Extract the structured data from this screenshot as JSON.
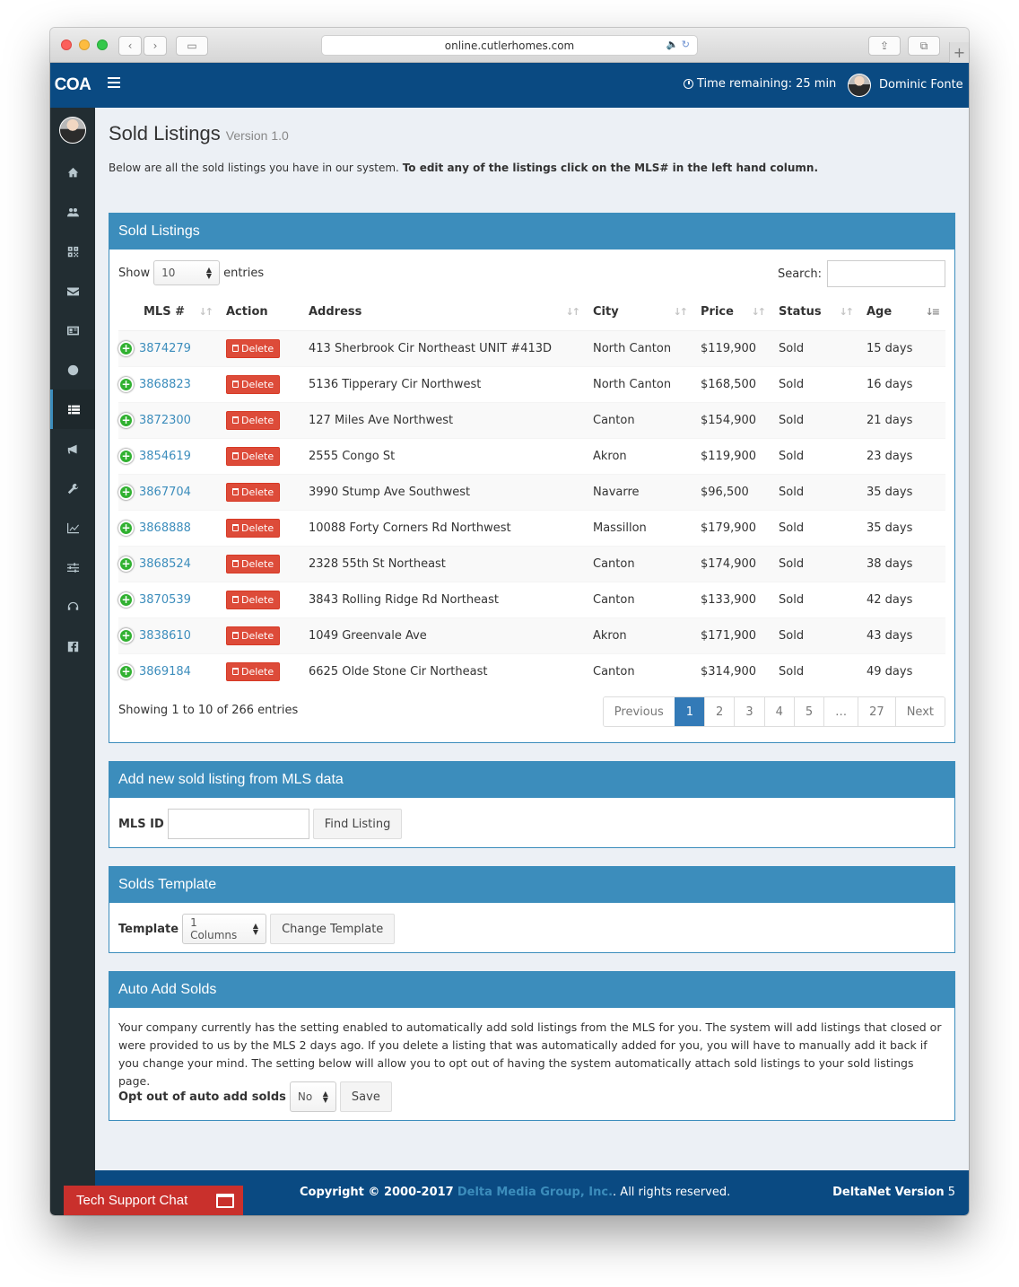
{
  "browser": {
    "url": "online.cutlerhomes.com"
  },
  "header": {
    "logo": "COA",
    "time_remaining": "Time remaining: 25 min",
    "user_name": "Dominic Fonte"
  },
  "sidebar": {
    "items": [
      {
        "icon": "home-icon"
      },
      {
        "icon": "users-icon"
      },
      {
        "icon": "qrcode-icon"
      },
      {
        "icon": "envelope-icon"
      },
      {
        "icon": "address-card-icon"
      },
      {
        "icon": "globe-icon"
      },
      {
        "icon": "list-icon",
        "active": true
      },
      {
        "icon": "bullhorn-icon"
      },
      {
        "icon": "wrench-icon"
      },
      {
        "icon": "line-chart-icon"
      },
      {
        "icon": "sliders-icon"
      },
      {
        "icon": "headset-icon"
      },
      {
        "icon": "facebook-icon"
      }
    ]
  },
  "page": {
    "title": "Sold Listings",
    "version": "Version 1.0",
    "intro_plain": "Below are all the sold listings you have in our system.",
    "intro_bold": "To edit any of the listings click on the MLS# in the left hand column."
  },
  "sold_listings": {
    "header": "Sold Listings",
    "show_label": "Show",
    "entries_label": "entries",
    "page_size": "10",
    "search_label": "Search:",
    "columns": [
      "MLS #",
      "Action",
      "Address",
      "City",
      "Price",
      "Status",
      "Age"
    ],
    "delete_label": "Delete",
    "rows": [
      {
        "mls": "3874279",
        "address": "413 Sherbrook Cir Northeast UNIT #413D",
        "city": "North Canton",
        "price": "$119,900",
        "status": "Sold",
        "age": "15 days"
      },
      {
        "mls": "3868823",
        "address": "5136 Tipperary Cir Northwest",
        "city": "North Canton",
        "price": "$168,500",
        "status": "Sold",
        "age": "16 days"
      },
      {
        "mls": "3872300",
        "address": "127 Miles Ave Northwest",
        "city": "Canton",
        "price": "$154,900",
        "status": "Sold",
        "age": "21 days"
      },
      {
        "mls": "3854619",
        "address": "2555 Congo St",
        "city": "Akron",
        "price": "$119,900",
        "status": "Sold",
        "age": "23 days"
      },
      {
        "mls": "3867704",
        "address": "3990 Stump Ave Southwest",
        "city": "Navarre",
        "price": "$96,500",
        "status": "Sold",
        "age": "35 days"
      },
      {
        "mls": "3868888",
        "address": "10088 Forty Corners Rd Northwest",
        "city": "Massillon",
        "price": "$179,900",
        "status": "Sold",
        "age": "35 days"
      },
      {
        "mls": "3868524",
        "address": "2328 55th St Northeast",
        "city": "Canton",
        "price": "$174,900",
        "status": "Sold",
        "age": "38 days"
      },
      {
        "mls": "3870539",
        "address": "3843 Rolling Ridge Rd Northeast",
        "city": "Canton",
        "price": "$133,900",
        "status": "Sold",
        "age": "42 days"
      },
      {
        "mls": "3838610",
        "address": "1049 Greenvale Ave",
        "city": "Akron",
        "price": "$171,900",
        "status": "Sold",
        "age": "43 days"
      },
      {
        "mls": "3869184",
        "address": "6625 Olde Stone Cir Northeast",
        "city": "Canton",
        "price": "$314,900",
        "status": "Sold",
        "age": "49 days"
      }
    ],
    "info": "Showing 1 to 10 of 266 entries",
    "pagination": [
      "Previous",
      "1",
      "2",
      "3",
      "4",
      "5",
      "…",
      "27",
      "Next"
    ],
    "current_page": "1"
  },
  "add_listing": {
    "header": "Add new sold listing from MLS data",
    "label": "MLS ID",
    "button": "Find Listing"
  },
  "template": {
    "header": "Solds Template",
    "label": "Template",
    "selected": "1 Columns",
    "button": "Change Template"
  },
  "auto_add": {
    "header": "Auto Add Solds",
    "description": "Your company currently has the setting enabled to automatically add sold listings from the MLS for you. The system will add listings that closed or were provided to us by the MLS 2 days ago. If you delete a listing that was automatically added for you, you will have to manually add it back if you change your mind. The setting below will allow you to opt out of having the system automatically attach sold listings to your sold listings page.",
    "label": "Opt out of auto add solds",
    "selected": "No",
    "button": "Save"
  },
  "footer": {
    "copyright_prefix": "Copyright © 2000-2017",
    "company": "Delta Media Group, Inc.",
    "rights": ". All rights reserved.",
    "version_label": "DeltaNet Version",
    "version_number": "5"
  },
  "chat": {
    "label": "Tech Support Chat"
  },
  "colors": {
    "header_blue": "#0a4a82",
    "box_blue": "#3c8dbc",
    "delete_red": "#dd4b39",
    "sidebar_dark": "#222d32",
    "chat_red": "#c9302c"
  }
}
